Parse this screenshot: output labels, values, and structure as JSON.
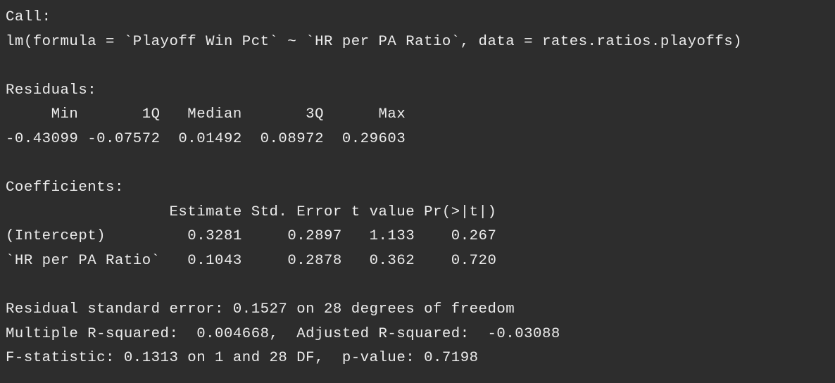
{
  "output": {
    "lines": [
      "Call:",
      "lm(formula = `Playoff Win Pct` ~ `HR per PA Ratio`, data = rates.ratios.playoffs)",
      "",
      "Residuals:",
      "     Min       1Q   Median       3Q      Max ",
      "-0.43099 -0.07572  0.01492  0.08972  0.29603 ",
      "",
      "Coefficients:",
      "                  Estimate Std. Error t value Pr(>|t|)",
      "(Intercept)         0.3281     0.2897   1.133    0.267",
      "`HR per PA Ratio`   0.1043     0.2878   0.362    0.720",
      "",
      "Residual standard error: 0.1527 on 28 degrees of freedom",
      "Multiple R-squared:  0.004668,\tAdjusted R-squared:  -0.03088 ",
      "F-statistic: 0.1313 on 1 and 28 DF,  p-value: 0.7198"
    ]
  }
}
